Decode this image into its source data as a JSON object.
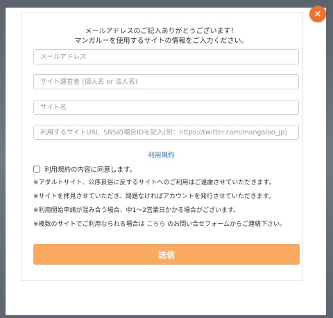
{
  "modal": {
    "intro_line1": "メールアドレスのご記入ありがとうございます！",
    "intro_line2": "マンガルーを使用するサイトの情報をご入力ください。"
  },
  "form": {
    "email_placeholder": "メールアドレス",
    "operator_placeholder": "サイト運営者 (個人名 or 法人名)",
    "site_name_placeholder": "サイト名",
    "url_placeholder": "利用するサイトURL  SNSの場合IDを記入(例：https://twitter.com/mangaloo_jp)",
    "email_value": "",
    "operator_value": "",
    "site_name_value": "",
    "url_value": ""
  },
  "terms": {
    "link_label": "利用規約",
    "agree_label": "利用規約の内容に同意します。",
    "agree_checked": false
  },
  "notes": {
    "adult": "※アダルトサイト、公序良俗に反するサイトへのご利用はご遠慮させていただきます。",
    "review": "※サイトを拝見させていただき、問題なければアカウントを発行させていただきます。",
    "delay": "※利用開始申請が混み合う場合、中1～2営業日かかる場合がございます。",
    "multi_before": "※複数のサイトでご利用なられる場合は ",
    "multi_link": "こちら",
    "multi_after": " のお問い合せフォームからご連絡下さい。"
  },
  "submit_label": "送信",
  "close_icon": "×",
  "colors": {
    "accent": "#f0712a",
    "submit": "#f9aa5f",
    "link": "#2a7bbd"
  }
}
